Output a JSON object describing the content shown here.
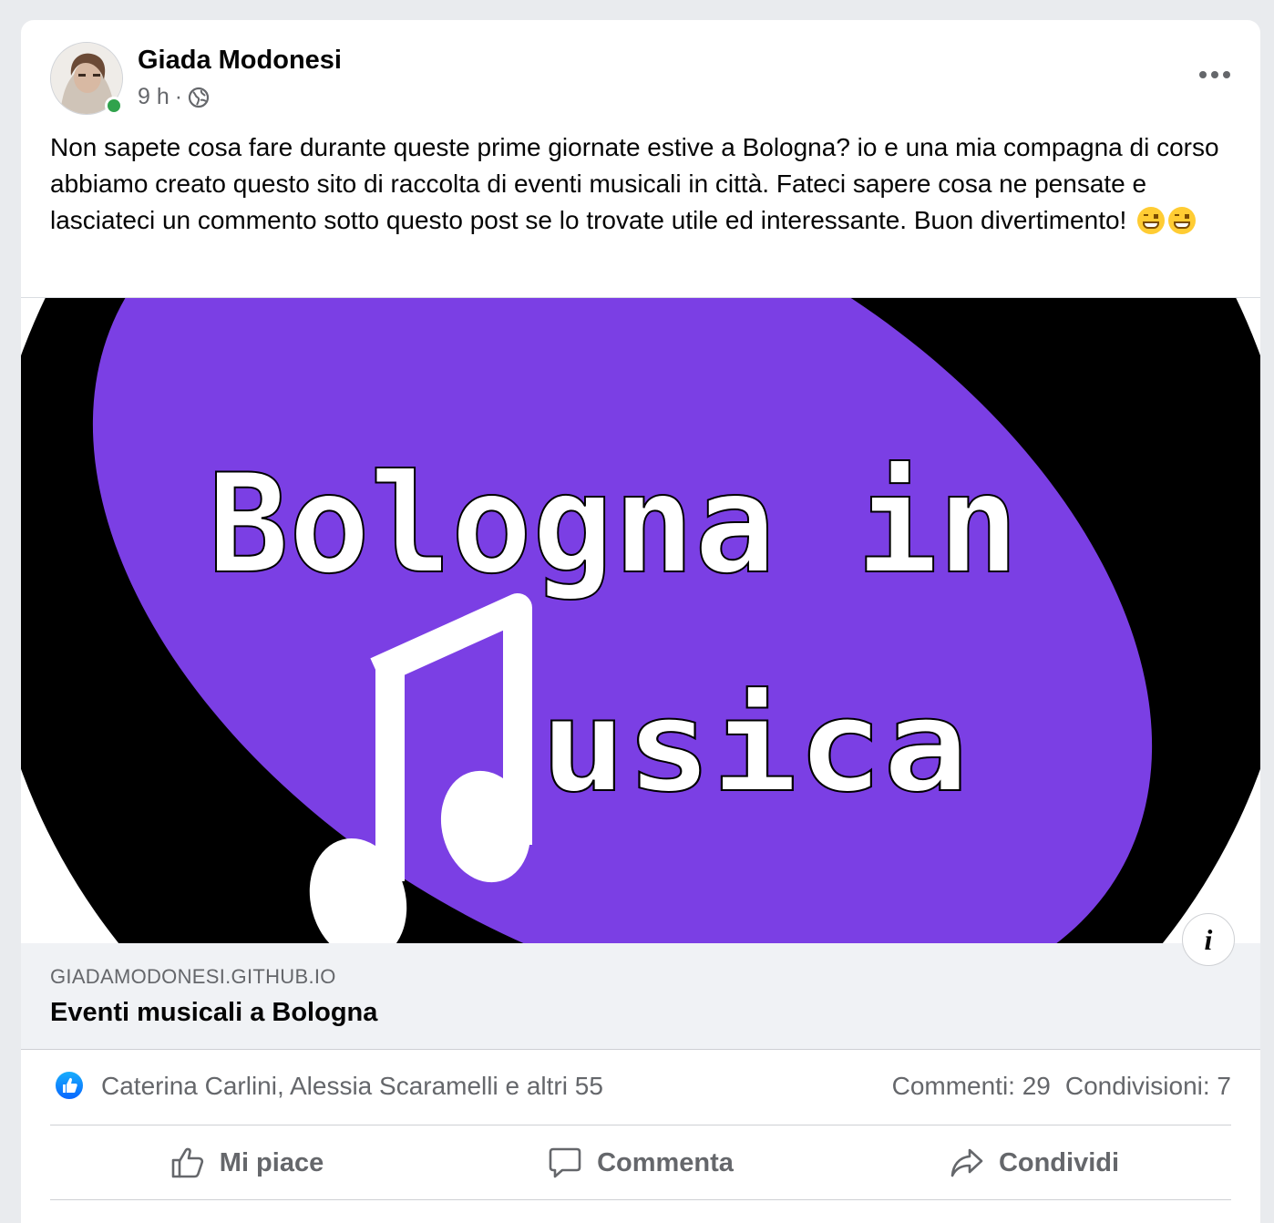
{
  "post": {
    "author": "Giada Modonesi",
    "time": "9 h",
    "separator": "·",
    "privacy_icon": "globe-icon",
    "more_icon": "more-options-icon",
    "text": "Non sapete cosa fare durante queste prime giornate estive a Bologna?  io e una mia compagna di corso abbiamo creato questo sito di raccolta di eventi musicali in città. Fateci sapere cosa ne pensate e lasciateci un commento sotto questo post se lo trovate utile ed interessante. Buon divertimento!",
    "emojis": [
      "grinning-face-emoji",
      "grinning-face-emoji"
    ]
  },
  "link_preview": {
    "image_text_line1": "Bologna in",
    "image_text_line2": "usica",
    "domain": "GIADAMODONESI.GITHUB.IO",
    "title": "Eventi musicali a Bologna",
    "info_label": "i",
    "colors": {
      "ellipse": "#7b3fe4",
      "background": "#000000",
      "text": "#ffffff"
    }
  },
  "reactions": {
    "icon": "like-reaction-icon",
    "reactors": "Caterina Carlini, Alessia Scaramelli e altri 55",
    "comments": "Commenti: 29",
    "shares": "Condivisioni: 7"
  },
  "actions": {
    "like": "Mi piace",
    "comment": "Commenta",
    "share": "Condividi"
  },
  "colors": {
    "accent": "#0866ff",
    "online": "#31a24c",
    "secondary_text": "#65676b"
  }
}
